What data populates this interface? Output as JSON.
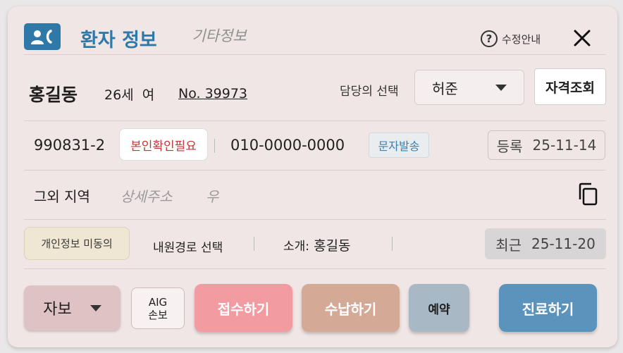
{
  "header": {
    "title": "환자 정보",
    "other_tab": "기타정보",
    "help_label": "수정안내",
    "help_symbol": "?",
    "icons": {
      "contact": "contact-card-icon",
      "help": "question-circle-icon",
      "close": "close-icon"
    },
    "accent_color": "#2f79a8"
  },
  "patient": {
    "name": "홍길동",
    "age_sex": "26세  여",
    "chart_no": "No. 39973",
    "doctor_label": "담당의 선택",
    "doctor_value": "허준",
    "eligibility_button": "자격조회"
  },
  "contact": {
    "rrn": "990831-2",
    "verify_badge": "본인확인필요",
    "phone": "010-0000-0000",
    "sms_button": "문자발송",
    "registered_label": "등록",
    "registered_date": "25-11-14"
  },
  "address": {
    "region": "그외 지역",
    "detail_placeholder": "상세주소",
    "zip_placeholder": "우",
    "copy_icon": "copy-icon"
  },
  "visit": {
    "consent_badge": "개인정보 미동의",
    "route_label": "내원경로 선택",
    "referral_label": "소개:",
    "referral_name": "홍길동",
    "recent_label": "최근",
    "recent_date": "25-11-20"
  },
  "actions": {
    "insurance_value": "자보",
    "aig_line1": "AIG",
    "aig_line2": "손보",
    "accept": "접수하기",
    "pay": "수납하기",
    "reserve": "예약",
    "treat": "진료하기",
    "colors": {
      "accept": "#f29ba1",
      "pay": "#d4a996",
      "reserve": "#a9b8c5",
      "treat": "#5a94bd"
    }
  }
}
